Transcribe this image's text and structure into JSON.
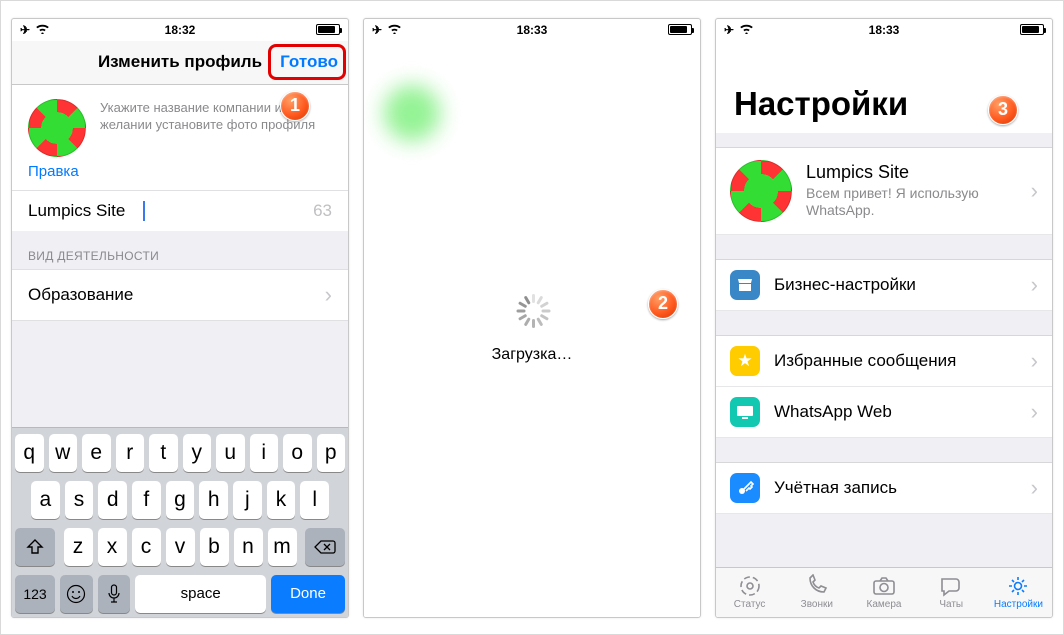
{
  "phone1": {
    "time": "18:32",
    "battery_pct": 80,
    "nav_title": "Изменить профиль",
    "done_label": "Готово",
    "hint": "Укажите название компании и при желании установите фото профиля",
    "edit_link": "Правка",
    "name_value": "Lumpics Site",
    "name_count": "63",
    "section_label": "ВИД ДЕЯТЕЛЬНОСТИ",
    "activity_value": "Образование",
    "kb": {
      "r1": [
        "q",
        "w",
        "e",
        "r",
        "t",
        "y",
        "u",
        "i",
        "o",
        "p"
      ],
      "r2": [
        "a",
        "s",
        "d",
        "f",
        "g",
        "h",
        "j",
        "k",
        "l"
      ],
      "r3": [
        "z",
        "x",
        "c",
        "v",
        "b",
        "n",
        "m"
      ],
      "num": "123",
      "space": "space",
      "done": "Done"
    }
  },
  "phone2": {
    "time": "18:33",
    "battery_pct": 80,
    "loading": "Загрузка…"
  },
  "phone3": {
    "time": "18:33",
    "battery_pct": 80,
    "title": "Настройки",
    "profile_name": "Lumpics Site",
    "profile_status": "Всем привет! Я использую WhatsApp.",
    "items": {
      "biz": "Бизнес-настройки",
      "star": "Избранные сообщения",
      "web": "WhatsApp Web",
      "account": "Учётная запись"
    },
    "tabs": {
      "status": "Статус",
      "calls": "Звонки",
      "camera": "Камера",
      "chats": "Чаты",
      "settings": "Настройки"
    }
  },
  "badges": {
    "b1": "1",
    "b2": "2",
    "b3": "3"
  }
}
